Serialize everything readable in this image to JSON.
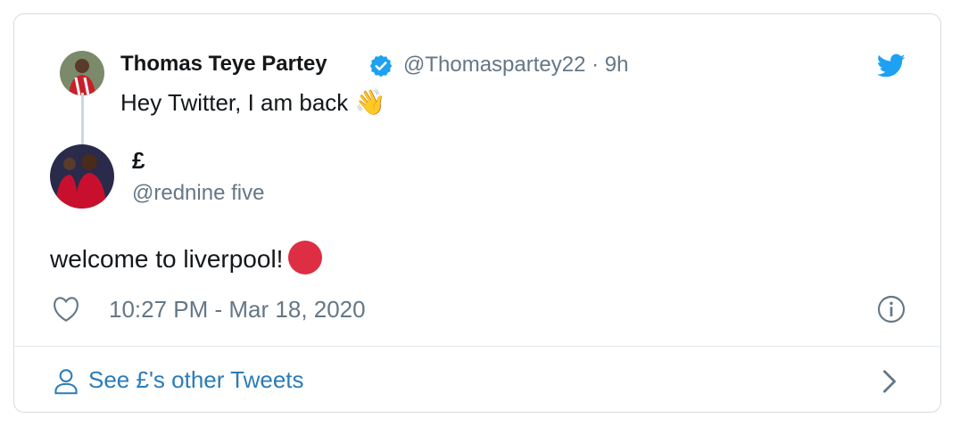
{
  "original_tweet": {
    "author_name": "Thomas Teye Partey",
    "handle_time": "@Thomaspartey22 · 9h",
    "text": "Hey Twitter, I am back",
    "emoji": "👋",
    "verified_icon": "verified-badge-icon"
  },
  "reply_tweet": {
    "author_name": "£",
    "handle": "@rednine five",
    "text": "welcome to liverpool!",
    "emoji_icon": "red-circle-icon",
    "timestamp": "10:27 PM - Mar 18, 2020"
  },
  "footer": {
    "see_other_label": "See £'s other Tweets"
  },
  "colors": {
    "twitter_blue": "#1da1f2",
    "link_blue": "#2b7bb9",
    "secondary_text": "#657786",
    "red_circle": "#dd2e44"
  }
}
